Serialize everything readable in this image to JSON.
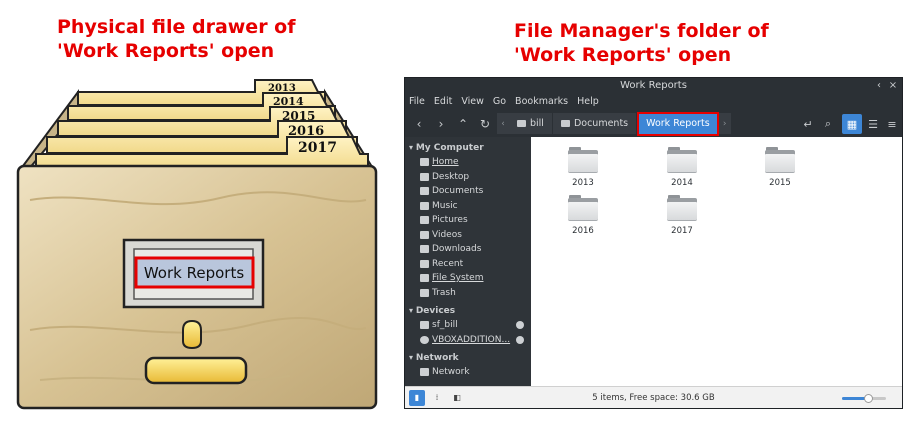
{
  "captions": {
    "left": [
      "Physical file drawer of",
      "'Work Reports' open"
    ],
    "right": [
      "File Manager's folder of",
      "'Work Reports' open"
    ]
  },
  "cabinet": {
    "folder_tabs": [
      "2013",
      "2014",
      "2015",
      "2016",
      "2017"
    ],
    "drawer_label": "Work Reports"
  },
  "file_manager": {
    "title": "Work Reports",
    "window_buttons": [
      "‹",
      "×"
    ],
    "menu": [
      "File",
      "Edit",
      "View",
      "Go",
      "Bookmarks",
      "Help"
    ],
    "breadcrumbs": [
      "bill",
      "Documents"
    ],
    "active_crumb": "Work Reports",
    "sidebar": {
      "my_computer_header": "My Computer",
      "places": [
        "Home",
        "Desktop",
        "Documents",
        "Music",
        "Pictures",
        "Videos",
        "Downloads",
        "Recent",
        "File System",
        "Trash"
      ],
      "devices_header": "Devices",
      "devices": [
        "sf_bill",
        "VBOXADDITION..."
      ],
      "network_header": "Network",
      "network": [
        "Network"
      ]
    },
    "folders": [
      "2013",
      "2014",
      "2015",
      "2016",
      "2017"
    ],
    "status_text": "5 items, Free space: 30.6 GB",
    "zoom_level": 0.6,
    "accent_color": "#3d86d6",
    "highlight_color": "#e60000"
  }
}
